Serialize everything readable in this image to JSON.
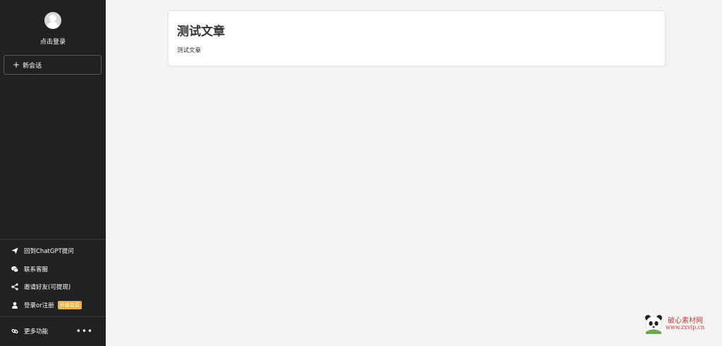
{
  "sidebar": {
    "login_label": "点击登录",
    "new_chat_label": "新会话",
    "menu": [
      {
        "label": "回到ChatGPT提问",
        "icon": "send-icon"
      },
      {
        "label": "联系客服",
        "icon": "wechat-icon"
      },
      {
        "label": "邀请好友(可提现)",
        "icon": "share-icon"
      },
      {
        "label": "登录or注册",
        "icon": "user-icon",
        "badge": "升级会员"
      }
    ],
    "more_label": "更多功能",
    "more_icon": "link-icon"
  },
  "article": {
    "title": "测试文章",
    "body": "测试文章"
  },
  "watermark": {
    "text": "破心素材网",
    "url": "www.zxvip.cn"
  },
  "colors": {
    "sidebar_bg": "#202123",
    "page_bg": "#f4f4f4",
    "badge": "#e8b34a",
    "watermark": "#c83c3c"
  }
}
